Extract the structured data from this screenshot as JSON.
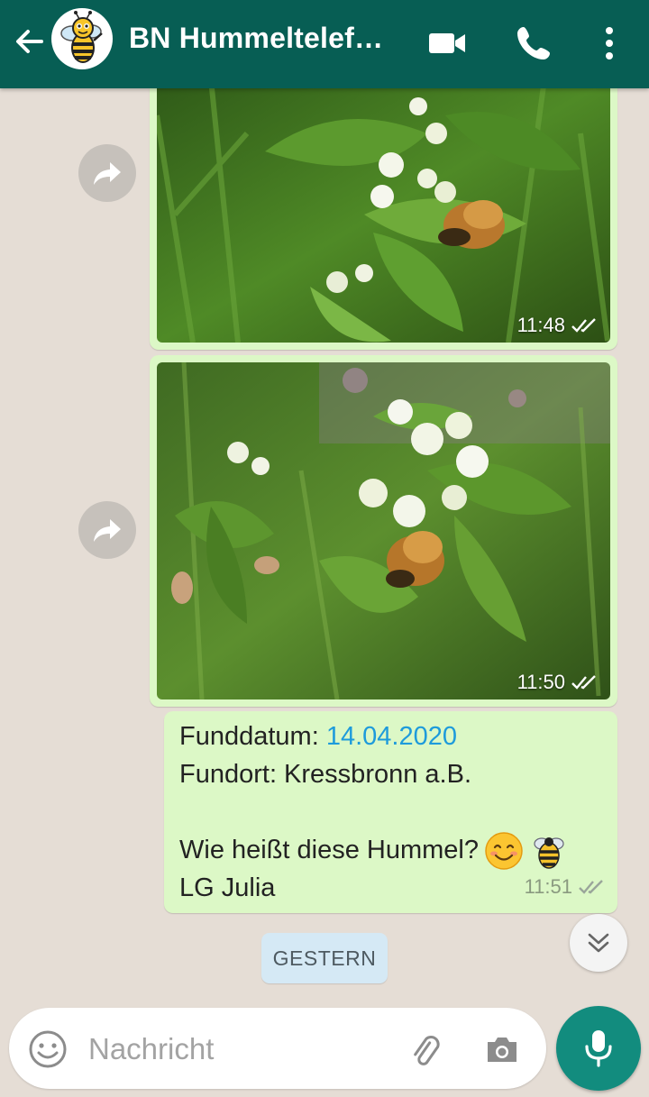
{
  "header": {
    "title": "BN Hummeltelef…",
    "icons": [
      "back-arrow-icon",
      "bee-avatar",
      "video-call-icon",
      "phone-icon",
      "more-vert-icon"
    ],
    "bg_color": "#075e54"
  },
  "messages": [
    {
      "type": "image",
      "time": "11:48",
      "status": "read-ticks",
      "forward_icon": "forward-icon"
    },
    {
      "type": "image",
      "time": "11:50",
      "status": "read-ticks",
      "forward_icon": "forward-icon"
    },
    {
      "type": "text",
      "date_label": "Funddatum: ",
      "date_value": "14.04.2020",
      "location": "Fundort: Kressbronn a.B.",
      "question": "Wie heißt diese Hummel?",
      "emojis": [
        "smiling-face-emoji",
        "bee-emoji"
      ],
      "signature": "LG Julia",
      "time": "11:51",
      "status": "delivered-ticks"
    }
  ],
  "day_chip": "GESTERN",
  "scroll_down_icon": "double-chevron-down-icon",
  "input": {
    "placeholder": "Nachricht",
    "icons": [
      "emoji-icon",
      "attach-icon",
      "camera-icon",
      "mic-icon"
    ],
    "mic_color": "#128c7e"
  },
  "colors": {
    "bubble": "#dcf8c6",
    "background": "#e5ddd5",
    "link": "#1e9bdb"
  }
}
